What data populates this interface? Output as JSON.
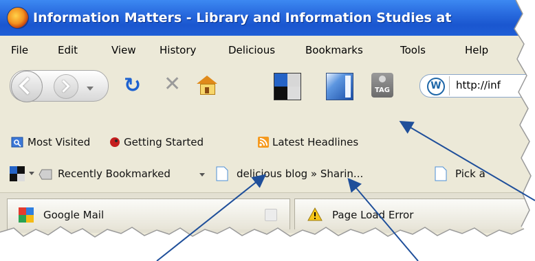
{
  "window": {
    "title": "Information Matters - Library and Information Studies at"
  },
  "menu": [
    "File",
    "Edit",
    "View",
    "History",
    "Delicious",
    "Bookmarks",
    "Tools",
    "Help"
  ],
  "navbar": {
    "url": "http://inf",
    "icons": [
      "back-icon",
      "forward-icon",
      "dropdown-icon",
      "reload-icon",
      "stop-icon",
      "home-icon",
      "delicious-bookmarks-icon",
      "delicious-sidebar-icon",
      "tag-icon",
      "wordpress-icon"
    ],
    "tag_label": "TAG"
  },
  "bookmarks_toolbar": {
    "items": [
      "Most Visited",
      "Getting Started",
      "Latest Headlines"
    ]
  },
  "delicious_toolbar": {
    "recently_bookmarked": "Recently Bookmarked",
    "items": [
      "delicious blog » Sharin...",
      "Pick a"
    ]
  },
  "tabs": [
    {
      "label": "Google Mail"
    },
    {
      "label": "Page Load Error"
    }
  ],
  "colors": {
    "titlebar": "#1f5fd6",
    "arrow": "#1f4f9a",
    "chrome": "#ece9d8"
  }
}
